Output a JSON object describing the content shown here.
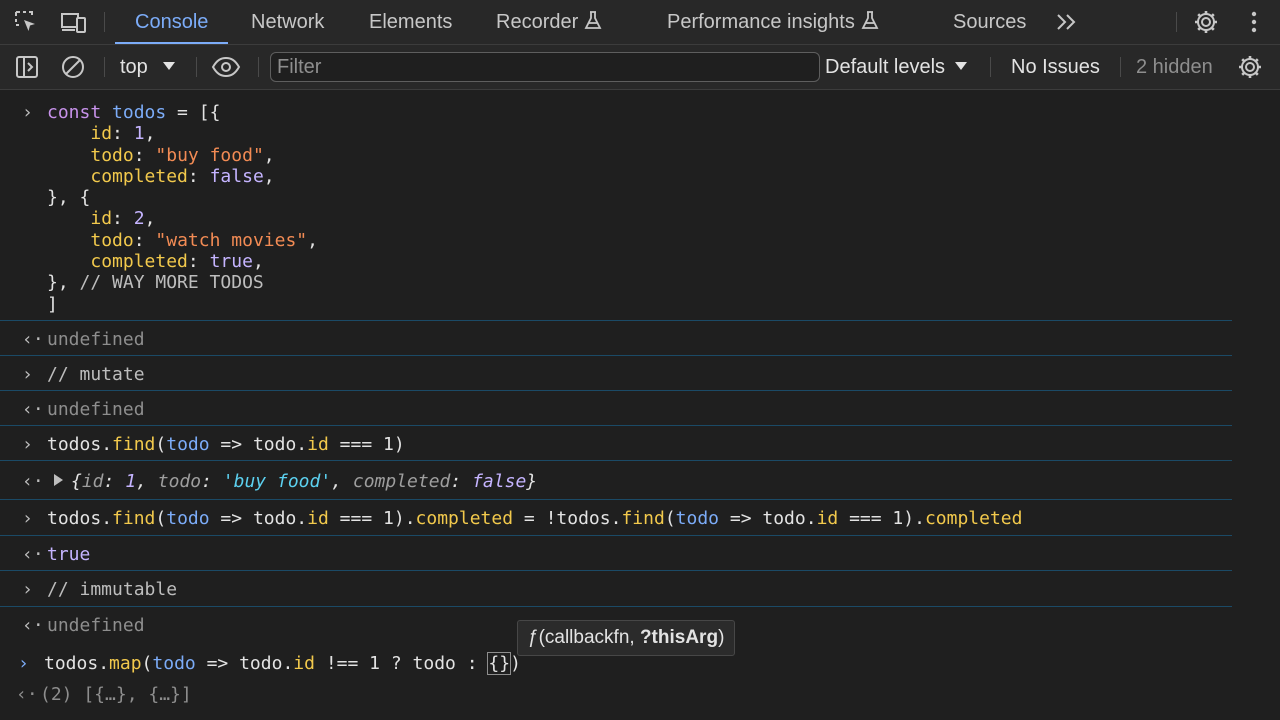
{
  "tabs": [
    {
      "label": "Console",
      "active": true
    },
    {
      "label": "Network"
    },
    {
      "label": "Elements"
    },
    {
      "label": "Recorder"
    },
    {
      "label": "Performance insights"
    },
    {
      "label": "Sources"
    }
  ],
  "toolbar": {
    "context": "top",
    "filter_placeholder": "Filter",
    "levels": "Default levels",
    "issues": "No Issues",
    "hidden": "2 hidden"
  },
  "console": {
    "block1": {
      "l1_kw": "const",
      "l1_var": "todos",
      "l1_rest": " = [{",
      "id_key": "id",
      "id1": "1",
      "todo_key": "todo",
      "todo1": "\"buy food\"",
      "completed_key": "completed",
      "false": "false",
      "mid": "}, {",
      "id2": "2",
      "todo2": "\"watch movies\"",
      "true": "true",
      "end": "}, ",
      "comment": "// WAY MORE TODOS",
      "close": "]"
    },
    "undefined": "undefined",
    "mutate": "// mutate",
    "find_obj": "todos",
    "find_method": "find",
    "arrow_param": "todo",
    "find_cond": " => todo.",
    "find_id": "id",
    "find_eq": " === 1)",
    "result_obj": {
      "open": "{",
      "id_key": "id",
      "id_val": "1",
      "todo_key": "todo",
      "todo_val": "'buy food'",
      "completed_key": "completed",
      "completed_val": "false",
      "close": "}"
    },
    "line_completed": {
      "prop": "completed",
      "mid": " = !todos.",
      "tail_prop": "completed"
    },
    "true_result": "true",
    "immutable": "// immutable",
    "map_method": "map",
    "map_cond_a": " => todo.",
    "map_cond_b": " !== 1 ? todo : ",
    "map_braces": "{}",
    "map_close": ")",
    "last_result": "(2) [{…}, {…}]"
  },
  "tooltip": {
    "prefix": "ƒ(callbackfn, ",
    "bold": "?thisArg",
    "suffix": ")"
  }
}
